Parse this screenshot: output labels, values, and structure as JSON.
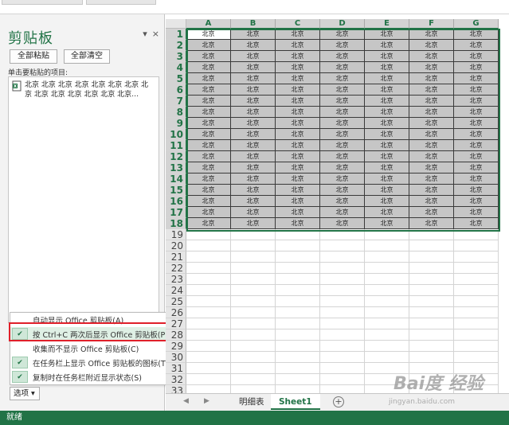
{
  "pane": {
    "title": "剪贴板",
    "dropdown_glyph": "▾",
    "close_glyph": "×",
    "paste_all_label": "全部粘贴",
    "clear_all_label": "全部清空",
    "hint": "单击要粘贴的项目:",
    "items": [
      {
        "text": "北京 北京 北京 北京 北京 北京 北京 北京 北京 北京 北京 北京 北京 北京…",
        "icon": "excel-clip-icon"
      }
    ]
  },
  "options_menu": {
    "items": [
      {
        "label": "自动显示 Office 剪贴板(A)",
        "checked": false
      },
      {
        "label": "按 Ctrl+C 两次后显示 Office 剪贴板(P)",
        "checked": true
      },
      {
        "label": "收集而不显示 Office 剪贴板(C)",
        "checked": false
      },
      {
        "label": "在任务栏上显示 Office 剪贴板的图标(T)",
        "checked": true
      },
      {
        "label": "复制时在任务栏附近显示状态(S)",
        "checked": true
      }
    ],
    "button_label": "选项 ▾",
    "check_glyph": "✔"
  },
  "sheet": {
    "columns": [
      "A",
      "B",
      "C",
      "D",
      "E",
      "F",
      "G"
    ],
    "rows": [
      "1",
      "2",
      "3",
      "4",
      "5",
      "6",
      "7",
      "8",
      "9",
      "10",
      "11",
      "12",
      "13",
      "14",
      "15",
      "16",
      "17",
      "18",
      "19",
      "20",
      "21",
      "22",
      "23",
      "24",
      "25",
      "26",
      "27",
      "28",
      "29",
      "30",
      "31",
      "32",
      "33"
    ],
    "cell_value": "北京",
    "filled_rows": 18
  },
  "tabs": {
    "nav_prev": "◀",
    "nav_next": "▶",
    "items": [
      {
        "label": "明细表",
        "active": false
      },
      {
        "label": "Sheet1",
        "active": true
      }
    ],
    "add_glyph": "+"
  },
  "watermark": {
    "main": "Bai度 经验",
    "sub": "jingyan.baidu.com"
  },
  "status": {
    "text": "就绪"
  },
  "colors": {
    "accent": "#217346",
    "highlight": "#e0202a"
  }
}
